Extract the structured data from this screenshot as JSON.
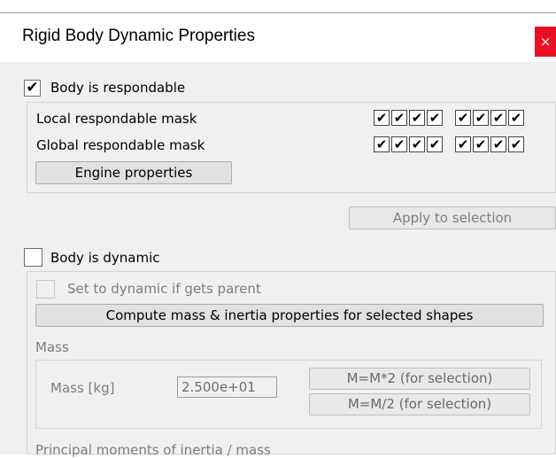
{
  "window": {
    "title": "Rigid Body Dynamic Properties",
    "close_glyph": "×"
  },
  "respondable": {
    "checkbox_label": "Body is respondable",
    "checked": true,
    "local_mask_label": "Local respondable mask",
    "global_mask_label": "Global respondable mask",
    "local_mask": [
      true,
      true,
      true,
      true,
      true,
      true,
      true,
      true
    ],
    "global_mask": [
      true,
      true,
      true,
      true,
      true,
      true,
      true,
      true
    ],
    "engine_button": "Engine properties",
    "apply_button": "Apply to selection"
  },
  "dynamic": {
    "checkbox_label": "Body is dynamic",
    "checked": false,
    "set_dynamic_label": "Set to dynamic if gets parent",
    "compute_button": "Compute mass & inertia properties for selected shapes"
  },
  "mass": {
    "group_label": "Mass",
    "field_label": "Mass [kg]",
    "value": "2.500e+01",
    "double_button": "M=M*2  (for selection)",
    "half_button": "M=M/2  (for selection)"
  },
  "inertia": {
    "group_label": "Principal moments of inertia / mass"
  },
  "check_glyph": "✔",
  "colors": {
    "close_bg": "#e81123",
    "panel_bg": "#f0f0f0",
    "disabled_text": "#7d7d7d"
  }
}
